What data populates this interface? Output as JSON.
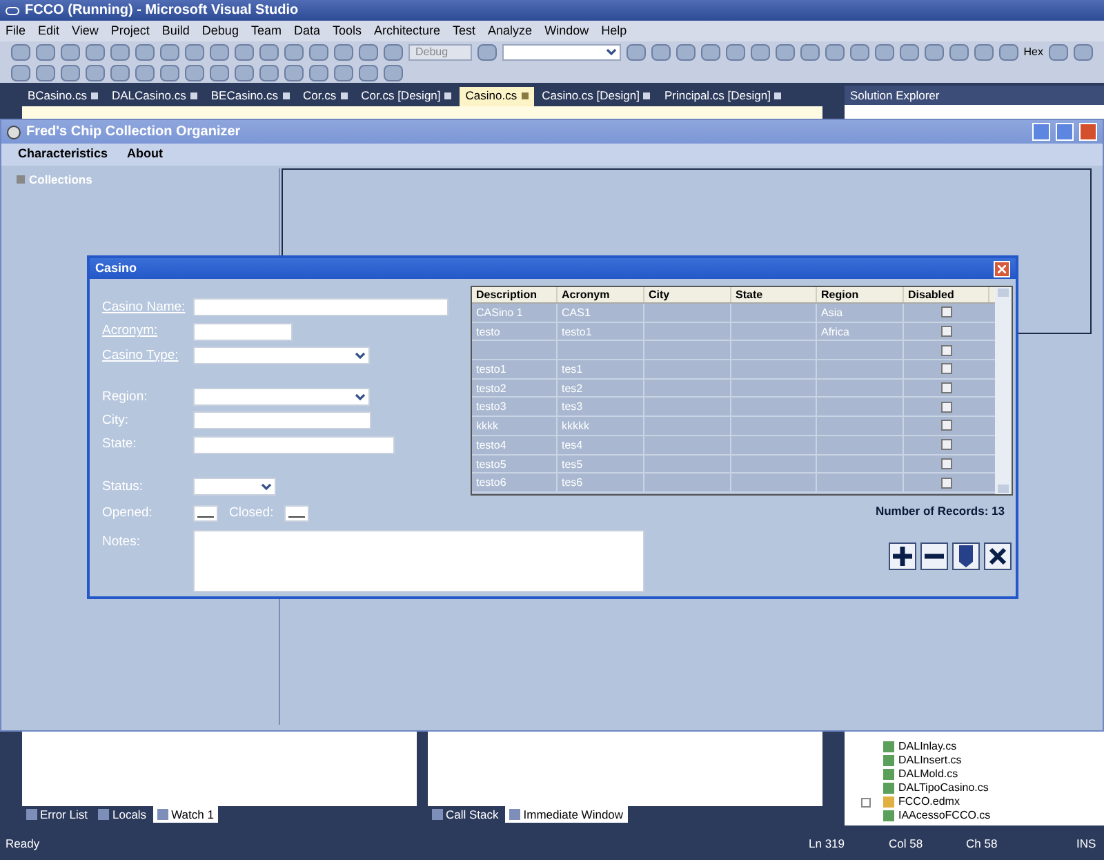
{
  "ide": {
    "title": "FCCO (Running) - Microsoft Visual Studio",
    "menu": [
      "File",
      "Edit",
      "View",
      "Project",
      "Build",
      "Debug",
      "Team",
      "Data",
      "Tools",
      "Architecture",
      "Test",
      "Analyze",
      "Window",
      "Help"
    ],
    "toolbar": {
      "config_combo": "Debug",
      "hex_label": "Hex"
    },
    "doc_tabs": [
      {
        "label": "BCasino.cs",
        "selected": false
      },
      {
        "label": "DALCasino.cs",
        "selected": false
      },
      {
        "label": "BECasino.cs",
        "selected": false
      },
      {
        "label": "Cor.cs",
        "selected": false
      },
      {
        "label": "Cor.cs [Design]",
        "selected": false
      },
      {
        "label": "Casino.cs",
        "selected": true
      },
      {
        "label": "Casino.cs [Design]",
        "selected": false
      },
      {
        "label": "Principal.cs [Design]",
        "selected": false
      }
    ],
    "solution_explorer": {
      "title": "Solution Explorer",
      "items": [
        {
          "label": "DALInlay.cs",
          "kind": "file"
        },
        {
          "label": "DALInsert.cs",
          "kind": "file"
        },
        {
          "label": "DALMold.cs",
          "kind": "file"
        },
        {
          "label": "DALTipoCasino.cs",
          "kind": "file"
        },
        {
          "label": "FCCO.edmx",
          "kind": "model"
        },
        {
          "label": "IAAcessoFCCO.cs",
          "kind": "file"
        }
      ]
    },
    "bottom_tabs_left": [
      {
        "label": "Error List",
        "selected": false
      },
      {
        "label": "Locals",
        "selected": false
      },
      {
        "label": "Watch 1",
        "selected": true
      }
    ],
    "bottom_tabs_right": [
      {
        "label": "Call Stack",
        "selected": false
      },
      {
        "label": "Immediate Window",
        "selected": true
      }
    ],
    "status_bar": {
      "text": "Ready",
      "line": "Ln 319",
      "col": "Col 58",
      "ch": "Ch 58",
      "mode": "INS"
    }
  },
  "app": {
    "title": "Fred's Chip Collection Organizer",
    "menu": [
      "Characteristics",
      "About"
    ],
    "tree": [
      {
        "label": "Collections",
        "expanded": false
      }
    ],
    "dialog": {
      "title": "Casino",
      "fields": [
        {
          "label": "Casino Name:",
          "kind": "text",
          "underlined": true
        },
        {
          "label": "Acronym:",
          "kind": "text",
          "underlined": true
        },
        {
          "label": "Casino Type:",
          "kind": "combo",
          "underlined": true
        },
        {
          "label": "Region:",
          "kind": "combo",
          "underlined": false
        },
        {
          "label": "City:",
          "kind": "text",
          "underlined": false
        },
        {
          "label": "State:",
          "kind": "text",
          "underlined": false
        },
        {
          "label": "Status:",
          "kind": "combo",
          "underlined": false
        },
        {
          "label": "Opened:",
          "kind": "date",
          "underlined": false
        },
        {
          "label": "Closed:",
          "kind": "date",
          "underlined": false
        },
        {
          "label": "Notes:",
          "kind": "notes",
          "underlined": false
        }
      ],
      "table": {
        "columns": [
          "Description",
          "Acronym",
          "City",
          "State",
          "Region",
          "Disabled"
        ],
        "rows": [
          {
            "cells": [
              "CASino 1",
              "CAS1",
              "",
              "",
              "Asia"
            ],
            "disabled": false
          },
          {
            "cells": [
              "testo",
              "testo1",
              "",
              "",
              "Africa"
            ],
            "disabled": false
          },
          {
            "cells": [
              "",
              "",
              "",
              "",
              ""
            ],
            "disabled": false
          },
          {
            "cells": [
              "testo1",
              "tes1",
              "",
              "",
              ""
            ],
            "disabled": false
          },
          {
            "cells": [
              "testo2",
              "tes2",
              "",
              "",
              ""
            ],
            "disabled": false
          },
          {
            "cells": [
              "testo3",
              "tes3",
              "",
              "",
              ""
            ],
            "disabled": false
          },
          {
            "cells": [
              "kkkk",
              "kkkkk",
              "",
              "",
              ""
            ],
            "disabled": false
          },
          {
            "cells": [
              "testo4",
              "tes4",
              "",
              "",
              ""
            ],
            "disabled": false
          },
          {
            "cells": [
              "testo5",
              "tes5",
              "",
              "",
              ""
            ],
            "disabled": false
          },
          {
            "cells": [
              "testo6",
              "tes6",
              "",
              "",
              ""
            ],
            "disabled": false
          }
        ]
      },
      "record_count": "Number of Records: 13",
      "buttons": [
        {
          "kind": "add"
        },
        {
          "kind": "remove"
        },
        {
          "kind": "save"
        },
        {
          "kind": "cancel"
        }
      ]
    }
  }
}
